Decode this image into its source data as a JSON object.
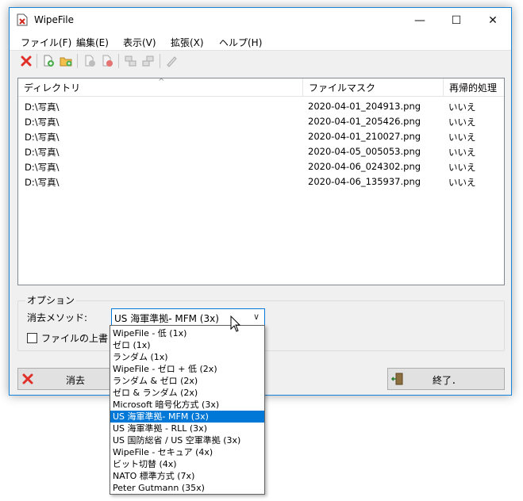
{
  "window": {
    "title": "WipeFile",
    "controls": {
      "minimize": "—",
      "maximize": "☐",
      "close": "✕"
    }
  },
  "menu": [
    {
      "label": "ファイル(F)"
    },
    {
      "label": "編集(E)"
    },
    {
      "label": "表示(V)"
    },
    {
      "label": "拡張(X)"
    },
    {
      "label": "ヘルプ(H)"
    }
  ],
  "toolbar": {
    "icons": [
      "delete-icon",
      "add-file-icon",
      "add-folder-icon",
      "remove-file-icon",
      "remove-all-icon",
      "move-up-icon",
      "move-down-icon",
      "edit-icon"
    ]
  },
  "list": {
    "columns": [
      "ディレクトリ",
      "ファイルマスク",
      "再帰的処理"
    ],
    "rows": [
      {
        "dir": "D:\\写真\\",
        "mask": "2020-04-01_204913.png",
        "recursive": "いいえ"
      },
      {
        "dir": "D:\\写真\\",
        "mask": "2020-04-01_205426.png",
        "recursive": "いいえ"
      },
      {
        "dir": "D:\\写真\\",
        "mask": "2020-04-01_210027.png",
        "recursive": "いいえ"
      },
      {
        "dir": "D:\\写真\\",
        "mask": "2020-04-05_005053.png",
        "recursive": "いいえ"
      },
      {
        "dir": "D:\\写真\\",
        "mask": "2020-04-06_024302.png",
        "recursive": "いいえ"
      },
      {
        "dir": "D:\\写真\\",
        "mask": "2020-04-06_135937.png",
        "recursive": "いいえ"
      }
    ]
  },
  "options": {
    "group_label": "オプション",
    "method_label": "消去メソッド:",
    "method_value": "US 海軍準拠- MFM (3x)",
    "overwrite_label": "ファイルの上書き完了後",
    "overwrite_checked": false
  },
  "buttons": {
    "erase_label": "消去",
    "exit_label": "終了．"
  },
  "dropdown": {
    "selected_index": 7,
    "options": [
      "WipeFile - 低 (1x)",
      "ゼロ (1x)",
      "ランダム (1x)",
      "WipeFile - ゼロ + 低 (2x)",
      "ランダム & ゼロ (2x)",
      "ゼロ & ランダム (2x)",
      "Microsoft 暗号化方式 (3x)",
      "US 海軍準拠- MFM (3x)",
      "US 海軍準拠 - RLL (3x)",
      "US 国防総省 / US 空軍準拠 (3x)",
      "WipeFile - セキュア (4x)",
      "ビット切替 (4x)",
      "NATO 標準方式 (7x)",
      "Peter Gutmann (35x)"
    ]
  }
}
